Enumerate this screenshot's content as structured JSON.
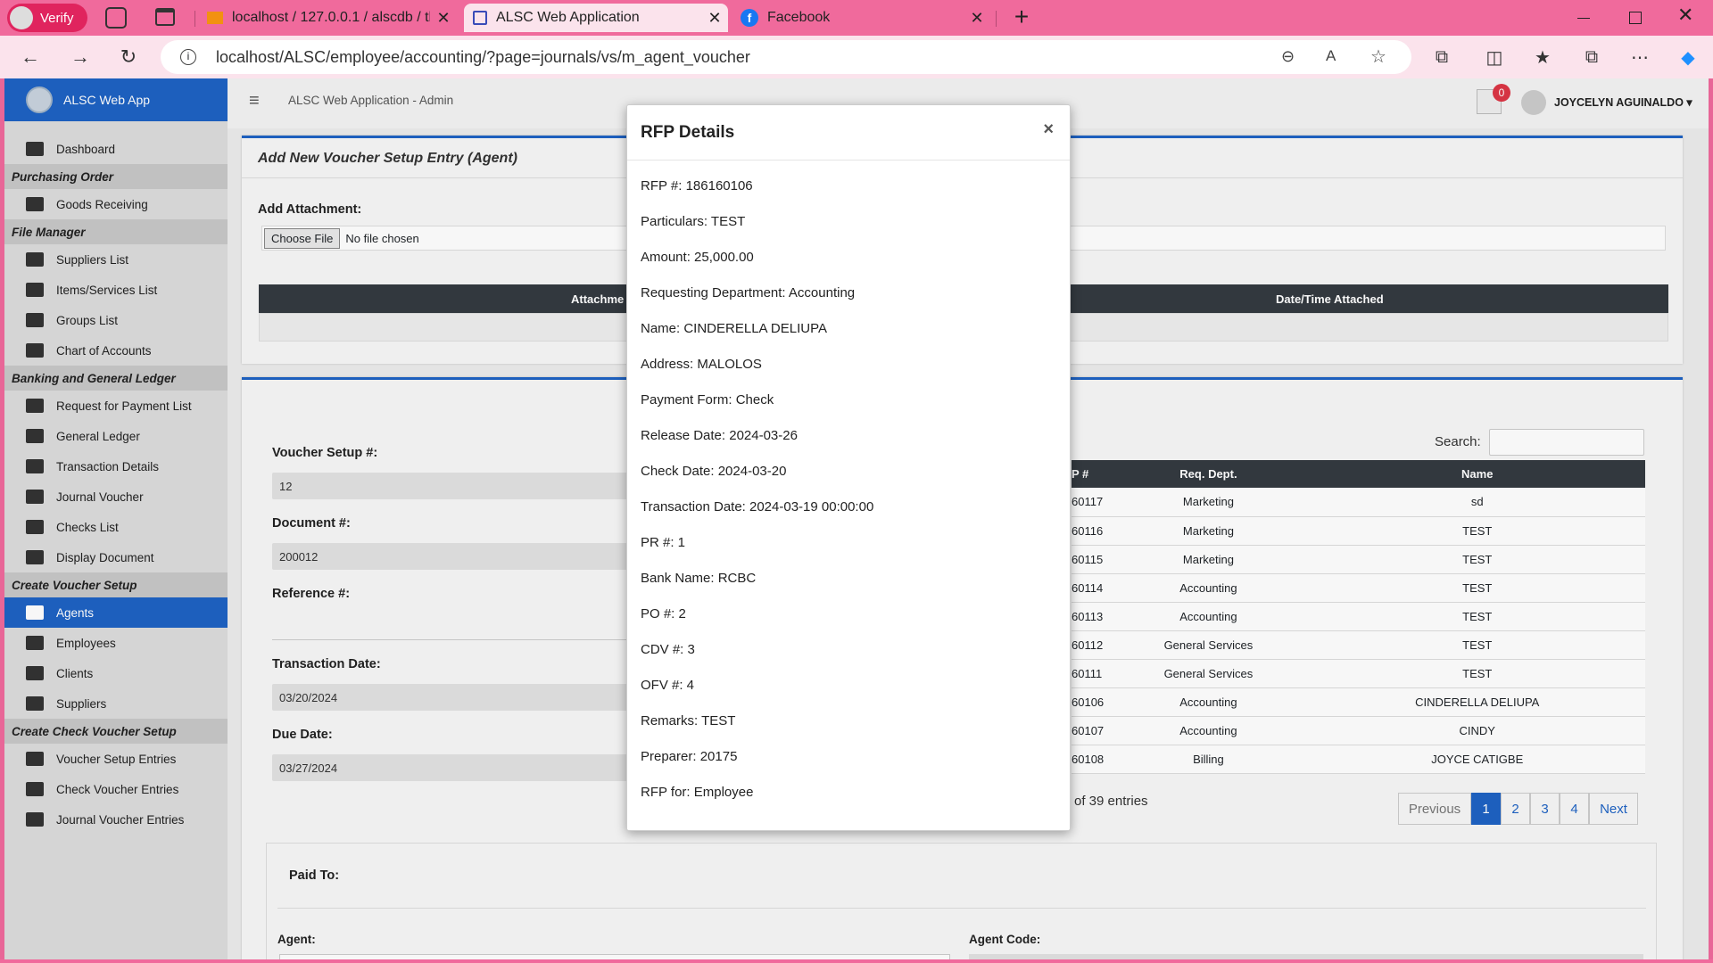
{
  "browser": {
    "profile_label": "Verify",
    "tabs": [
      {
        "title": "localhost / 127.0.0.1 / alscdb / tb",
        "active": false
      },
      {
        "title": "ALSC Web Application",
        "active": true
      },
      {
        "title": "Facebook",
        "active": false
      }
    ],
    "url": "localhost/ALSC/employee/accounting/?page=journals/vs/m_agent_voucher"
  },
  "app": {
    "brand": "ALSC Web App",
    "topbar_title": "ALSC Web Application - Admin",
    "notification_count": "0",
    "user_name": "JOYCELYN AGUINALDO"
  },
  "sidebar": {
    "dashboard": "Dashboard",
    "sections": [
      {
        "title": "Purchasing Order",
        "items": [
          "Goods Receiving"
        ]
      },
      {
        "title": "File Manager",
        "items": [
          "Suppliers List",
          "Items/Services List",
          "Groups List",
          "Chart of Accounts"
        ]
      },
      {
        "title": "Banking and General Ledger",
        "items": [
          "Request for Payment List",
          "General Ledger",
          "Transaction Details",
          "Journal Voucher",
          "Checks List",
          "Display Document"
        ]
      },
      {
        "title": "Create Voucher Setup",
        "items": [
          "Agents",
          "Employees",
          "Clients",
          "Suppliers"
        ]
      },
      {
        "title": "Create Check Voucher Setup",
        "items": [
          "Voucher Setup Entries",
          "Check Voucher Entries",
          "Journal Voucher Entries"
        ]
      }
    ],
    "active_item": "Agents"
  },
  "page": {
    "card_title": "Add New Voucher Setup Entry (Agent)",
    "add_attachment_label": "Add Attachment:",
    "choose_file_label": "Choose File",
    "no_file_text": "No file chosen",
    "attach_table_headers": [
      "Attachme",
      "Date/Time Attached"
    ],
    "voucher_setup_label": "Voucher Setup #:",
    "voucher_setup_value": "12",
    "document_label": "Document #:",
    "document_value": "200012",
    "reference_label": "Reference #:",
    "transaction_date_label": "Transaction Date:",
    "transaction_date_value": "03/20/2024",
    "due_date_label": "Due Date:",
    "due_date_value": "03/27/2024",
    "search_label": "Search:",
    "table_headers": [
      "P #",
      "Req. Dept.",
      "Name"
    ],
    "table_rows": [
      [
        "60117",
        "Marketing",
        "sd"
      ],
      [
        "60116",
        "Marketing",
        "TEST"
      ],
      [
        "60115",
        "Marketing",
        "TEST"
      ],
      [
        "60114",
        "Accounting",
        "TEST"
      ],
      [
        "60113",
        "Accounting",
        "TEST"
      ],
      [
        "60112",
        "General Services",
        "TEST"
      ],
      [
        "60111",
        "General Services",
        "TEST"
      ],
      [
        "60106",
        "Accounting",
        "CINDERELLA DELIUPA"
      ],
      [
        "60107",
        "Accounting",
        "CINDY"
      ],
      [
        "60108",
        "Billing",
        "JOYCE CATIGBE"
      ]
    ],
    "entries_info": "of 39 entries",
    "pagination": [
      "Previous",
      "1",
      "2",
      "3",
      "4",
      "Next"
    ],
    "paid_to_label": "Paid To:",
    "agent_label": "Agent:",
    "agent_code_label": "Agent Code:"
  },
  "modal": {
    "title": "RFP Details",
    "close": "×",
    "rows": [
      "RFP #: 186160106",
      "Particulars: TEST",
      "Amount: 25,000.00",
      "Requesting Department: Accounting",
      "Name: CINDERELLA DELIUPA",
      "Address: MALOLOS",
      "Payment Form: Check",
      "Release Date: 2024-03-26",
      "Check Date: 2024-03-20",
      "Transaction Date: 2024-03-19 00:00:00",
      "PR #: 1",
      "Bank Name: RCBC",
      "PO #: 2",
      "CDV #: 3",
      "OFV #: 4",
      "Remarks: TEST",
      "Preparer: 20175",
      "RFP for: Employee"
    ]
  },
  "colors": {
    "browser_accent": "#f06a9c",
    "primary": "#1e63c4",
    "table_header": "#343a40"
  }
}
